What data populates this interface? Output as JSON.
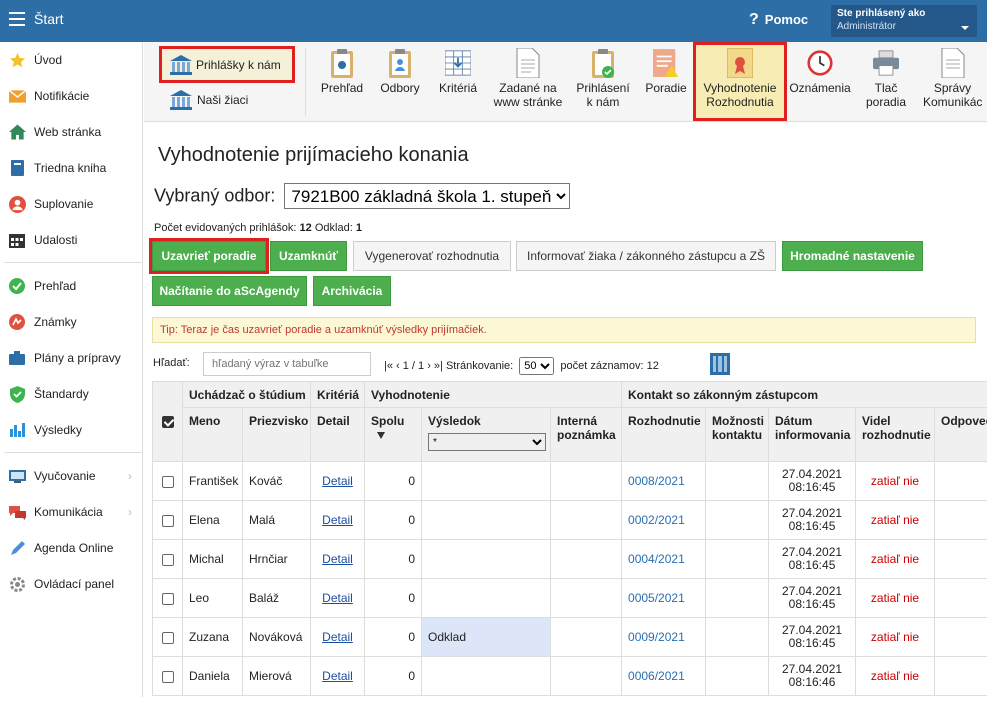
{
  "topbar": {
    "title": "Štart",
    "help": "Pomoc",
    "user_line1": "Ste prihlásený ako",
    "user_line2": "Administrátor"
  },
  "sidebar": {
    "items": [
      {
        "label": "Úvod",
        "icon": "star-icon"
      },
      {
        "label": "Notifikácie",
        "icon": "envelope-icon"
      },
      {
        "label": "Web stránka",
        "icon": "home-icon"
      },
      {
        "label": "Triedna kniha",
        "icon": "book-icon"
      },
      {
        "label": "Suplovanie",
        "icon": "substitute-icon"
      },
      {
        "label": "Udalosti",
        "icon": "calendar-icon"
      },
      {
        "label": "Prehľad",
        "icon": "check-icon"
      },
      {
        "label": "Známky",
        "icon": "grades-icon"
      },
      {
        "label": "Plány a prípravy",
        "icon": "plans-icon"
      },
      {
        "label": "Štandardy",
        "icon": "shield-icon"
      },
      {
        "label": "Výsledky",
        "icon": "bar-chart-icon"
      },
      {
        "label": "Vyučovanie",
        "icon": "teaching-icon"
      },
      {
        "label": "Komunikácia",
        "icon": "chat-icon"
      },
      {
        "label": "Agenda Online",
        "icon": "pen-icon"
      },
      {
        "label": "Ovládací panel",
        "icon": "gear-icon"
      }
    ]
  },
  "ribbon": {
    "prihlasky": "Prihlášky k nám",
    "ziaci": "Naši žiaci",
    "buttons": [
      {
        "l1": "Prehľad",
        "l2": ""
      },
      {
        "l1": "Odbory",
        "l2": ""
      },
      {
        "l1": "Kritériá",
        "l2": ""
      },
      {
        "l1": "Zadané na",
        "l2": "www stránke"
      },
      {
        "l1": "Prihlásení",
        "l2": "k nám"
      },
      {
        "l1": "Poradie",
        "l2": ""
      },
      {
        "l1": "Vyhodnotenie",
        "l2": "Rozhodnutia"
      },
      {
        "l1": "Oznámenia",
        "l2": ""
      },
      {
        "l1": "Tlač",
        "l2": "poradia"
      },
      {
        "l1": "Správy",
        "l2": "Komunikác"
      }
    ]
  },
  "page": {
    "title": "Vyhodnotenie prijímacieho konania",
    "odbor_label": "Vybraný odbor:",
    "odbor_value": "7921B00 základná škola 1. stupeň",
    "count_label": "Počet evidovaných prihlášok:",
    "count_value": "12",
    "odklad_label": "Odklad:",
    "odklad_value": "1"
  },
  "actions": {
    "uzavriet": "Uzavrieť poradie",
    "uzamknut": "Uzamknúť",
    "vygenerovat": "Vygenerovať rozhodnutia",
    "informovat": "Informovať žiaka / zákonného zástupcu a ZŠ",
    "hromadne": "Hromadné nastavenie",
    "nacitanie": "Načítanie do aScAgendy",
    "archivacia": "Archivácia"
  },
  "tip": "Tip: Teraz je čas uzavrieť poradie a uzamknúť výsledky prijímačiek.",
  "search": {
    "label": "Hľadať:",
    "placeholder": "hľadaný výraz v tabuľke"
  },
  "pager": {
    "nav": "|« ‹ 1 / 1 › »|",
    "page_label": "Stránkovanie:",
    "page_size": "50",
    "count_label": "počet záznamov:",
    "count": "12"
  },
  "table": {
    "group_headers": {
      "uchadzac": "Uchádzač o štúdium",
      "kriteria": "Kritériá",
      "vyhodnotenie": "Vyhodnotenie",
      "kontakt": "Kontakt so zákonným zástupcom"
    },
    "columns": {
      "meno": "Meno",
      "priezvisko": "Priezvisko",
      "detail": "Detail",
      "spolu": "Spolu",
      "vysledok": "Výsledok",
      "interna": "Interná poznámka",
      "rozhodnutie": "Rozhodnutie",
      "moznosti": "Možnosti kontaktu",
      "datum": "Dátum informovania",
      "videl": "Videl rozhodnutie",
      "odpoved": "Odpoveď"
    },
    "filter_value": "*",
    "rows": [
      {
        "meno": "František",
        "priezvisko": "Kováč",
        "detail": "Detail",
        "spolu": "0",
        "vysledok": "",
        "rozhodnutie": "0008/2021",
        "datum": "27.04.2021",
        "cas": "08:16:45",
        "videl": "zatiaľ nie"
      },
      {
        "meno": "Elena",
        "priezvisko": "Malá",
        "detail": "Detail",
        "spolu": "0",
        "vysledok": "",
        "rozhodnutie": "0002/2021",
        "datum": "27.04.2021",
        "cas": "08:16:45",
        "videl": "zatiaľ nie"
      },
      {
        "meno": "Michal",
        "priezvisko": "Hrnčiar",
        "detail": "Detail",
        "spolu": "0",
        "vysledok": "",
        "rozhodnutie": "0004/2021",
        "datum": "27.04.2021",
        "cas": "08:16:45",
        "videl": "zatiaľ nie"
      },
      {
        "meno": "Leo",
        "priezvisko": "Baláž",
        "detail": "Detail",
        "spolu": "0",
        "vysledok": "",
        "rozhodnutie": "0005/2021",
        "datum": "27.04.2021",
        "cas": "08:16:45",
        "videl": "zatiaľ nie"
      },
      {
        "meno": "Zuzana",
        "priezvisko": "Nováková",
        "detail": "Detail",
        "spolu": "0",
        "vysledok": "Odklad",
        "rozhodnutie": "0009/2021",
        "datum": "27.04.2021",
        "cas": "08:16:45",
        "videl": "zatiaľ nie"
      },
      {
        "meno": "Daniela",
        "priezvisko": "Mierová",
        "detail": "Detail",
        "spolu": "0",
        "vysledok": "",
        "rozhodnutie": "0006/2021",
        "datum": "27.04.2021",
        "cas": "08:16:46",
        "videl": "zatiaľ nie"
      }
    ]
  },
  "colors": {
    "topbar": "#2d6ea7",
    "green": "#4cae4c",
    "highlight": "#e02020",
    "link": "#1a4fa0",
    "red_text": "#cc0000"
  }
}
